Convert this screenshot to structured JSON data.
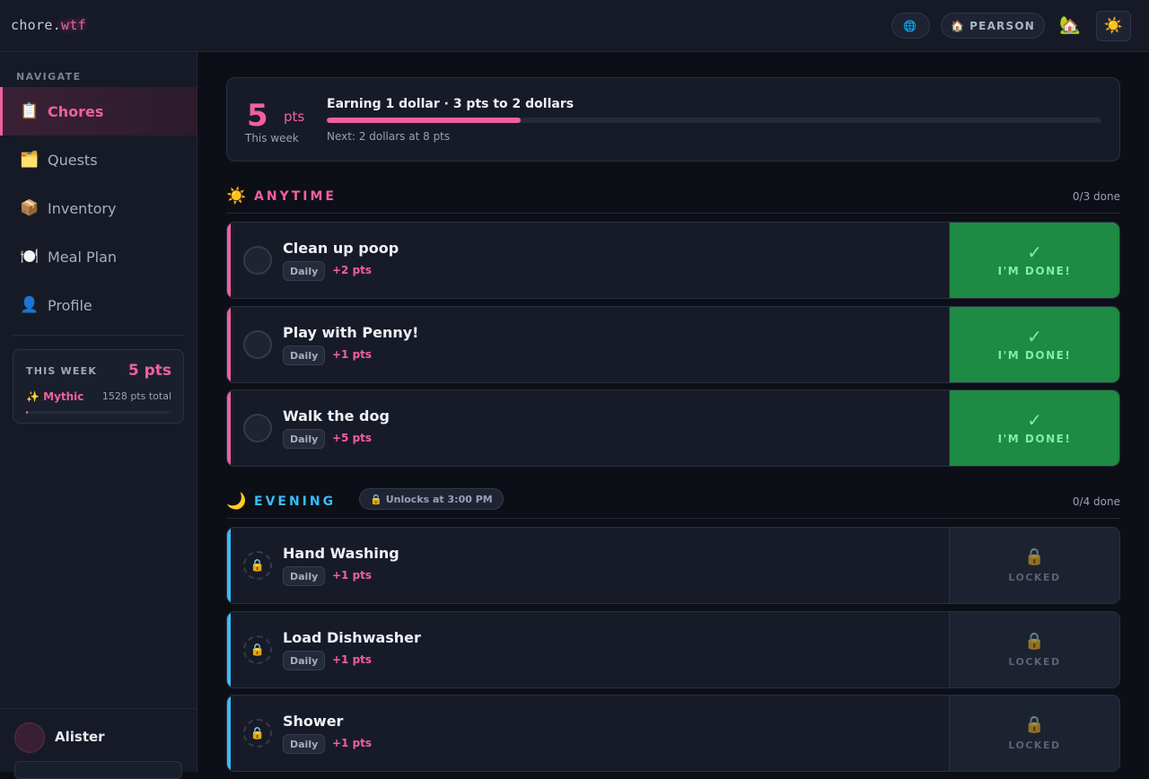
{
  "app": {
    "logo_main": "chore.",
    "logo_accent": "wtf"
  },
  "topbar": {
    "globe_icon": "🌐",
    "household_icon": "🏠",
    "household_label": "PEARSON",
    "house_emoji": "🏡",
    "theme_icon": "☀️"
  },
  "sidebar": {
    "heading": "NAVIGATE",
    "items": [
      {
        "icon": "📋",
        "label": "Chores",
        "active": true
      },
      {
        "icon": "🗂️",
        "label": "Quests"
      },
      {
        "icon": "📦",
        "label": "Inventory"
      },
      {
        "icon": "🍽️",
        "label": "Meal Plan"
      },
      {
        "icon": "👤",
        "label": "Profile"
      }
    ],
    "week_card": {
      "label": "THIS WEEK",
      "points": "5 pts",
      "rank_icon": "✨",
      "rank": "Mythic",
      "total": "1528 pts total",
      "progress": 0.01
    },
    "user": {
      "name": "Alister"
    }
  },
  "points_card": {
    "points": "5",
    "unit": "pts",
    "period": "This week",
    "earning": "Earning 1 dollar · 3 pts to 2 dollars",
    "next": "Next: 2 dollars at 8 pts",
    "progress": 0.25
  },
  "sections": {
    "anytime": {
      "icon": "☀️",
      "title": "ANYTIME",
      "done": "0/3 done",
      "color": "#f0609e"
    },
    "evening": {
      "icon": "🌙",
      "title": "EVENING",
      "unlock_icon": "🔒",
      "unlock_text": "Unlocks at 3:00 PM",
      "done": "0/4 done",
      "color": "#38bdf8"
    }
  },
  "chores": [
    {
      "title": "Clean up poop",
      "freq": "Daily",
      "pts": "+2 pts",
      "action": "I'M DONE!",
      "check": "✓"
    },
    {
      "title": "Play with Penny!",
      "freq": "Daily",
      "pts": "+1 pts",
      "action": "I'M DONE!",
      "check": "✓"
    },
    {
      "title": "Walk the dog",
      "freq": "Daily",
      "pts": "+5 pts",
      "action": "I'M DONE!",
      "check": "✓"
    },
    {
      "title": "Hand Washing",
      "freq": "Daily",
      "pts": "+1 pts",
      "action": "LOCKED",
      "lock": "🔒"
    },
    {
      "title": "Load Dishwasher",
      "freq": "Daily",
      "pts": "+1 pts",
      "action": "LOCKED",
      "lock": "🔒"
    },
    {
      "title": "Shower",
      "freq": "Daily",
      "pts": "+1 pts",
      "action": "LOCKED",
      "lock": "🔒"
    }
  ]
}
